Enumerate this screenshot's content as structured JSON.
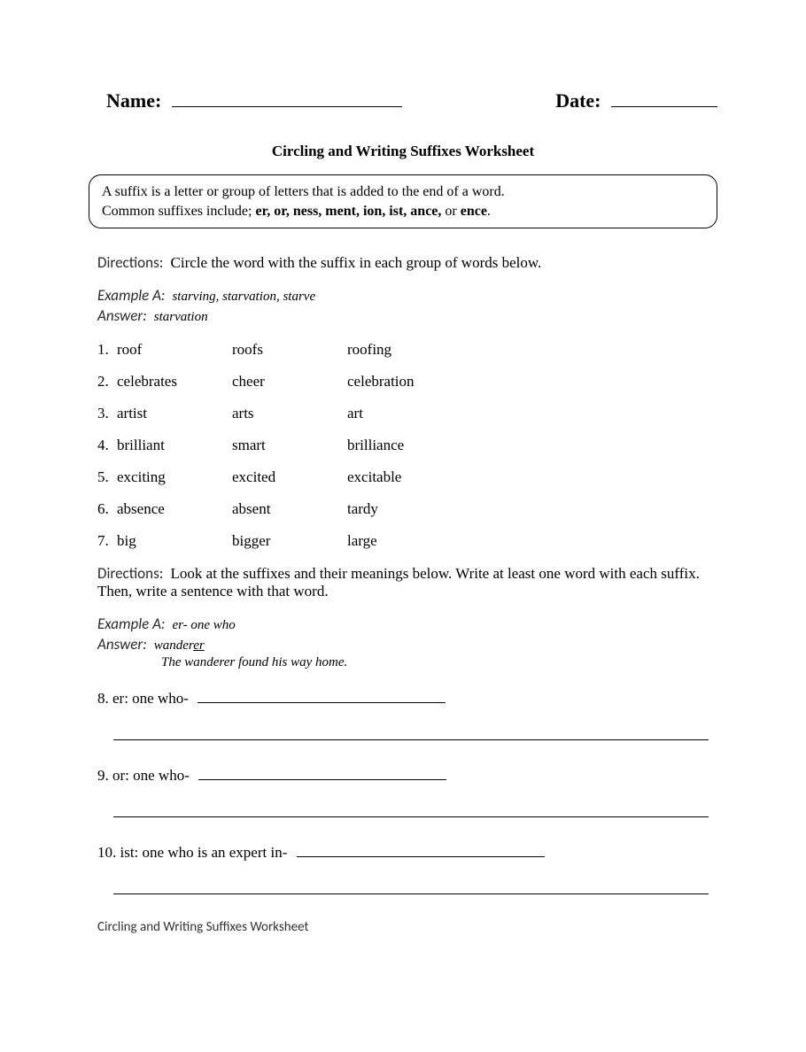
{
  "header": {
    "name_label": "Name:",
    "date_label": "Date:"
  },
  "title": "Circling and Writing Suffixes Worksheet",
  "infobox": {
    "line1": "A suffix is a letter or group of letters that is added to the end of a word.",
    "line2_prefix": "Common suffixes include; ",
    "suffixes": "er, or, ness, ment, ion, ist, ance,",
    "line2_suffix": " or ",
    "last_suffix": "ence",
    "period": "."
  },
  "section1": {
    "directions_label": "Directions:",
    "directions_text": "Circle the word with the suffix in each group of words below.",
    "example_label": "Example A:",
    "example_text": "starving, starvation, starve",
    "answer_label": "Answer:",
    "answer_text": "starvation",
    "items": [
      {
        "n": "1.",
        "w1": "roof",
        "w2": "roofs",
        "w3": "roofing"
      },
      {
        "n": "2.",
        "w1": "celebrates",
        "w2": "cheer",
        "w3": "celebration"
      },
      {
        "n": "3.",
        "w1": "artist",
        "w2": "arts",
        "w3": "art"
      },
      {
        "n": "4.",
        "w1": "brilliant",
        "w2": "smart",
        "w3": "brilliance"
      },
      {
        "n": "5.",
        "w1": "exciting",
        "w2": "excited",
        "w3": "excitable"
      },
      {
        "n": "6.",
        "w1": "absence",
        "w2": "absent",
        "w3": "tardy"
      },
      {
        "n": "7.",
        "w1": "big",
        "w2": "bigger",
        "w3": "large"
      }
    ]
  },
  "section2": {
    "directions_label": "Directions:",
    "directions_text": "Look at the suffixes and their meanings below. Write at least one word with each suffix. Then, write a sentence with that word.",
    "example_label": "Example A:",
    "example_text": "er- one who",
    "answer_label": "Answer:",
    "answer_word_root": "wander",
    "answer_word_suffix": "er",
    "answer_sentence": "The wanderer found his way home.",
    "items": [
      {
        "n": "8.",
        "prompt": "er: one who-"
      },
      {
        "n": "9.",
        "prompt": "or: one who-"
      },
      {
        "n": "10.",
        "prompt": "ist: one who is an expert in-"
      }
    ]
  },
  "footer": "Circling and Writing Suffixes Worksheet"
}
